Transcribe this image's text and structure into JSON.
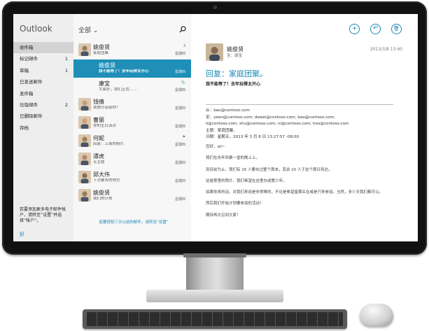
{
  "app": {
    "title": "Outlook"
  },
  "nav": {
    "folders": [
      {
        "label": "收件箱",
        "count": "",
        "selected": true
      },
      {
        "label": "标记邮件",
        "count": "1"
      },
      {
        "label": "草稿",
        "count": "1"
      },
      {
        "label": "已发送邮件",
        "count": ""
      },
      {
        "label": "发件箱",
        "count": ""
      },
      {
        "label": "垃圾邮件",
        "count": "2"
      },
      {
        "label": "已删除邮件",
        "count": ""
      },
      {
        "label": "存档",
        "count": ""
      }
    ],
    "hint": "若要添加更多电子邮件帐户，请转至“设置”并选择“帐户”。",
    "ok": "好"
  },
  "list": {
    "filter": "全部 ⌄",
    "items": [
      {
        "sender": "姚俊贤",
        "subject": "家庭团聚",
        "top": "3",
        "bottom": "星期四",
        "reply": false
      },
      {
        "sender": "姚俊贤",
        "subject": "我不能等了！去年玩得太开心",
        "top": "",
        "bottom": "星期四",
        "reply": true,
        "selected": true
      },
      {
        "sender": "康宝",
        "subject": "大家好，我们正在……",
        "top": "📎",
        "bottom": "星期四",
        "reply": true
      },
      {
        "sender": "钱倩",
        "subject": "我想分享给你！",
        "top": "",
        "bottom": "星期四",
        "reply": false
      },
      {
        "sender": "曹丽",
        "subject": "你的生日派对",
        "top": "",
        "bottom": "星期四",
        "reply": false
      },
      {
        "sender": "何妮",
        "subject": "回复：上周的照片",
        "top": "⚑",
        "bottom": "星期四",
        "reply": false
      },
      {
        "sender": "谭虎",
        "subject": "无主题",
        "top": "",
        "bottom": "星期四",
        "reply": false
      },
      {
        "sender": "邱大伟",
        "subject": "下次要去的地方",
        "top": "",
        "bottom": "星期四",
        "reply": false
      },
      {
        "sender": "姚俊贤",
        "subject": "我们的计划",
        "top": "",
        "bottom": "星期四",
        "reply": false
      }
    ],
    "footer": "若要获取三天以前的邮件，请转至“设置”"
  },
  "reading": {
    "actions": [
      "+",
      "↶",
      "🗑"
    ],
    "sender": "姚俊贤",
    "to": "至：康宝",
    "date": "2013/3/8   13:40",
    "title": "回复：家庭团聚。",
    "subtitle": "我不能等了！去年玩得太开心",
    "header_lines": [
      "从：bao@contoso.com",
      "至：yeen@contoso.com; dewei@contoso.com; bao@contoso.com;",
      "li@contoso.com; shu@contoso.com; ni@contoso.com; hoo@contoso.com",
      "主题：家庭团聚。",
      "日期：星期五，2013 年 3 月 8 日 13:27:57 -08:00"
    ],
    "body": [
      "您好，all~",
      "我们在去年欢聚一堂的晚上上。",
      "到目前为止，我们有 26 人要去过整个周末，其余 20 人于这个周日到达。",
      "这是那里的照片，我们希望在这里办成第六年。",
      "如果你来的话，对我们来说是非常棒的，不论是希望星期五在或是只来参加，当然，多少天我们都可以。",
      "然后我们开始计划要参加的活动！",
      "期待再次见到大家！"
    ]
  },
  "colors": {
    "accent": "#1f8fb8",
    "nav_bg": "#eeeeee",
    "list_bg": "#f7f7f7"
  }
}
